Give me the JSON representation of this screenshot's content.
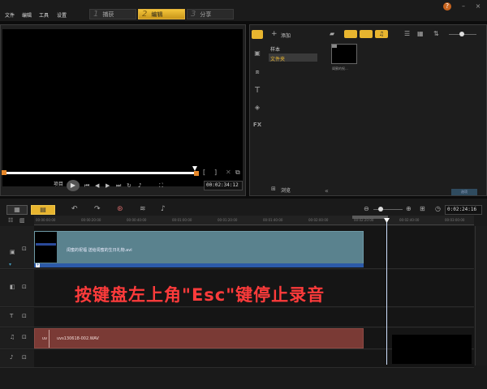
{
  "menu": {
    "file": "文件",
    "edit": "编辑",
    "tools": "工具",
    "settings": "设置"
  },
  "steps": [
    {
      "num": "1",
      "label": "捕获"
    },
    {
      "num": "2",
      "label": "编辑"
    },
    {
      "num": "3",
      "label": "分享"
    }
  ],
  "window": {
    "help": "?",
    "minimize": "–",
    "close": "×"
  },
  "preview": {
    "mode_label": "项目",
    "timecode": "00:02:34:12"
  },
  "library": {
    "add_label": "添加",
    "folders": [
      "样本",
      "文件夹"
    ],
    "browse_label": "浏览",
    "thumb_caption": "闺蜜的祝...",
    "sort_label": "选项"
  },
  "timeline": {
    "timecode": "0:02:24:16",
    "ticks": [
      "00:00:00:00",
      "00:00:20:00",
      "00:00:40:00",
      "00:01:00:00",
      "00:01:20:00",
      "00:01:40:00",
      "00:02:00:00",
      "00:02:20:00",
      "00:02:40:00",
      "00:03:00:00"
    ],
    "video_clip": "闺蜜的祝福 送给闺蜜的生日礼物.avi",
    "audio_clip": "uvs130618-002.WAV",
    "audio_prefix": "uv",
    "overlay": "按键盘左上角\"Esc\"键停止录音"
  },
  "colors": {
    "accent": "#e8b52f",
    "video_clip": "#5a828e",
    "audio_clip": "#7a3a35",
    "overlay_text": "#ff3b3b"
  }
}
